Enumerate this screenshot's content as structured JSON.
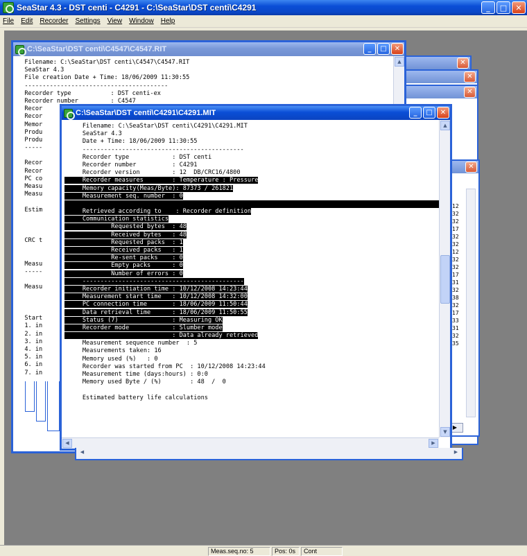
{
  "app": {
    "title": "SeaStar 4.3 - DST centi - C4291 - C:\\SeaStar\\DST centi\\C4291",
    "menus": [
      "File",
      "Edit",
      "Recorder",
      "Settings",
      "View",
      "Window",
      "Help"
    ],
    "status": {
      "panel1": "Meas.seq.no: 5",
      "panel2": "Pos: 0s",
      "panel3": "Cont"
    }
  },
  "icons": {
    "app_icon": "seastar-app-icon",
    "minimize": "minimize-icon",
    "maximize": "maximize-icon",
    "close": "close-icon"
  },
  "glyphs": {
    "minimize": "_",
    "maximize": "□",
    "close": "✕",
    "up": "▲",
    "down": "▼",
    "left": "◀",
    "right": "▶"
  },
  "colors": {
    "titlebar_active": "#0a4ed6",
    "close_button": "#d8421a",
    "mdi_background": "#808080",
    "highlight": "#000000"
  },
  "back_window": {
    "title": "C:\\SeaStar\\DST centi\\C4547\\C4547.RIT",
    "lines": [
      "  Filename: C:\\SeaStar\\DST centi\\C4547\\C4547.RIT",
      "  SeaStar 4.3",
      "  File creation Date + Time: 18/06/2009 11:30:55",
      "  ----------------------------------------",
      "  Recorder type           : DST centi-ex",
      "  Recorder number         : C4547",
      "  Recor",
      "  Recor",
      "  Memor",
      "  Produ",
      "  Produ",
      "  -----",
      "",
      "  Recor",
      "  Recor",
      "  PC co",
      "  Measu",
      "  Measu",
      "",
      "  Estim",
      "",
      "",
      "",
      "  CRC t",
      "",
      "",
      "  Measu",
      "  -----",
      "",
      "  Measu",
      "",
      "",
      "",
      "  Start",
      "  1. in",
      "  2. in",
      "  3. in",
      "  4. in",
      "  5. in",
      "  6. in",
      "  7. in"
    ]
  },
  "front_window": {
    "title": "C:\\SeaStar\\DST centi\\C4291\\C4291.MIT",
    "lines": [
      {
        "text": "     Filename: C:\\SeaStar\\DST centi\\C4291\\C4291.MIT",
        "hl": false
      },
      {
        "text": "     SeaStar 4.3",
        "hl": false
      },
      {
        "text": "     Date + Time: 18/06/2009 11:30:55",
        "hl": false
      },
      {
        "text": "     ---------------------------------------------",
        "hl": false
      },
      {
        "text": "     Recorder type            : DST centi",
        "hl": false
      },
      {
        "text": "     Recorder number          : C4291",
        "hl": false
      },
      {
        "text": "     Recorder version         : 12  DB/CRC16/4800",
        "hl": false
      },
      {
        "text": "     Recorder measures        : Temperature : Pressure",
        "hl": true
      },
      {
        "text": "     Memory capacity(Meas/Byte): 87373 / 261821",
        "hl": true
      },
      {
        "text": "     Measurement seq. number  : 0",
        "hl": true
      },
      {
        "text": "",
        "hl": true
      },
      {
        "text": "     Retrieved according to    : Recorder definition",
        "hl": true
      },
      {
        "text": "     Communication statistics",
        "hl": true
      },
      {
        "text": "             Requested bytes  : 48",
        "hl": true
      },
      {
        "text": "             Received bytes   : 48",
        "hl": true
      },
      {
        "text": "             Requested packs  : 1",
        "hl": true
      },
      {
        "text": "             Received packs   : 1",
        "hl": true
      },
      {
        "text": "             Re-sent packs    : 0",
        "hl": true
      },
      {
        "text": "             Empty packs      : 0",
        "hl": true
      },
      {
        "text": "             Number of errors : 0",
        "hl": true
      },
      {
        "text": "     ---------------------------------------------",
        "hl": true
      },
      {
        "text": "     Recorder initiation time : 10/12/2008 14:23:44",
        "hl": true
      },
      {
        "text": "     Measurement start time   : 10/12/2008 14:32:00",
        "hl": true
      },
      {
        "text": "     PC connection time       : 18/06/2009 11:50:44",
        "hl": true
      },
      {
        "text": "     Data retrieval time      : 18/06/2009 11:50:55",
        "hl": true
      },
      {
        "text": "     Status (7)               : Measuring OK",
        "hl": true
      },
      {
        "text": "     Recorder mode            : Slumber mode",
        "hl": true
      },
      {
        "text": "                              : Data already retrieved",
        "hl": true
      },
      {
        "text": "     Measurement sequence number  : 5",
        "hl": false
      },
      {
        "text": "     Measurements taken: 16",
        "hl": false
      },
      {
        "text": "     Memory used (%)   : 0",
        "hl": false
      },
      {
        "text": "     Recorder was started from PC  : 10/12/2008 14:23:44",
        "hl": false
      },
      {
        "text": "     Measurement time (days:hours) : 0:0",
        "hl": false
      },
      {
        "text": "     Memory used Byte / (%)        : 48  /  0",
        "hl": false
      },
      {
        "text": "",
        "hl": false
      },
      {
        "text": "     Estimated battery life calculations",
        "hl": false
      }
    ]
  },
  "side_numbers": [
    "12",
    "32",
    "32",
    "17",
    "32",
    "32",
    "12",
    "32",
    "32",
    "17",
    "31",
    "32",
    "38",
    "32",
    "17",
    "33",
    "31",
    "32",
    "35"
  ]
}
